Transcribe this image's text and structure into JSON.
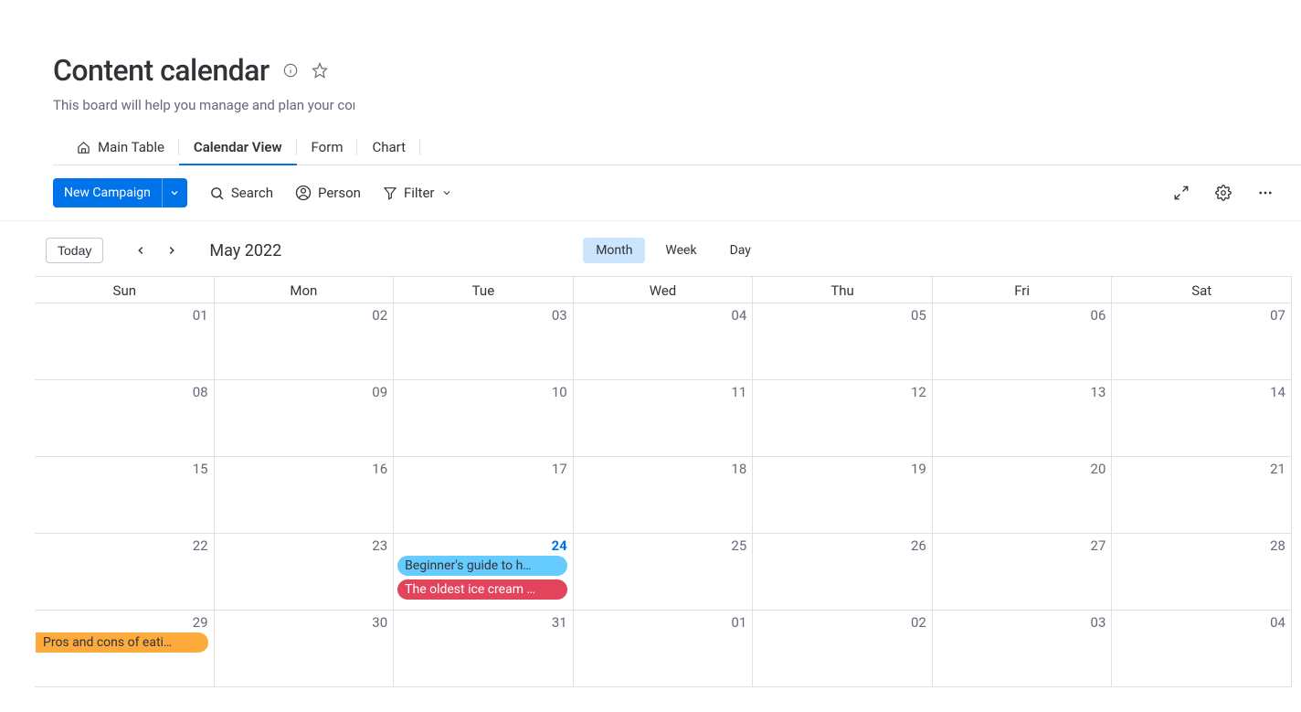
{
  "page": {
    "title": "Content calendar",
    "subtitle": "This board will help you manage and plan your conte"
  },
  "tabs": [
    {
      "label": "Main Table",
      "icon": "home"
    },
    {
      "label": "Calendar View",
      "active": true
    },
    {
      "label": "Form"
    },
    {
      "label": "Chart"
    }
  ],
  "toolbar": {
    "new_campaign": "New Campaign",
    "search": "Search",
    "person": "Person",
    "filter": "Filter"
  },
  "controls": {
    "today": "Today",
    "period": "May 2022",
    "views": [
      {
        "label": "Month",
        "active": true
      },
      {
        "label": "Week"
      },
      {
        "label": "Day"
      }
    ]
  },
  "calendar": {
    "weekdays": [
      "Sun",
      "Mon",
      "Tue",
      "Wed",
      "Thu",
      "Fri",
      "Sat"
    ],
    "weeks": [
      [
        {
          "n": "01"
        },
        {
          "n": "02"
        },
        {
          "n": "03"
        },
        {
          "n": "04"
        },
        {
          "n": "05"
        },
        {
          "n": "06"
        },
        {
          "n": "07"
        }
      ],
      [
        {
          "n": "08"
        },
        {
          "n": "09"
        },
        {
          "n": "10"
        },
        {
          "n": "11"
        },
        {
          "n": "12"
        },
        {
          "n": "13"
        },
        {
          "n": "14"
        }
      ],
      [
        {
          "n": "15"
        },
        {
          "n": "16"
        },
        {
          "n": "17"
        },
        {
          "n": "18"
        },
        {
          "n": "19"
        },
        {
          "n": "20"
        },
        {
          "n": "21"
        }
      ],
      [
        {
          "n": "22"
        },
        {
          "n": "23"
        },
        {
          "n": "24",
          "today": true,
          "events": [
            {
              "label": "Beginner's guide to h…",
              "color": "blue"
            },
            {
              "label": "The oldest ice cream …",
              "color": "pink"
            }
          ]
        },
        {
          "n": "25"
        },
        {
          "n": "26"
        },
        {
          "n": "27"
        },
        {
          "n": "28"
        }
      ],
      [
        {
          "n": "29",
          "events": [
            {
              "label": "Pros and cons of eati…",
              "color": "orange",
              "first": true
            }
          ]
        },
        {
          "n": "30"
        },
        {
          "n": "31"
        },
        {
          "n": "01"
        },
        {
          "n": "02"
        },
        {
          "n": "03"
        },
        {
          "n": "04"
        }
      ]
    ]
  }
}
